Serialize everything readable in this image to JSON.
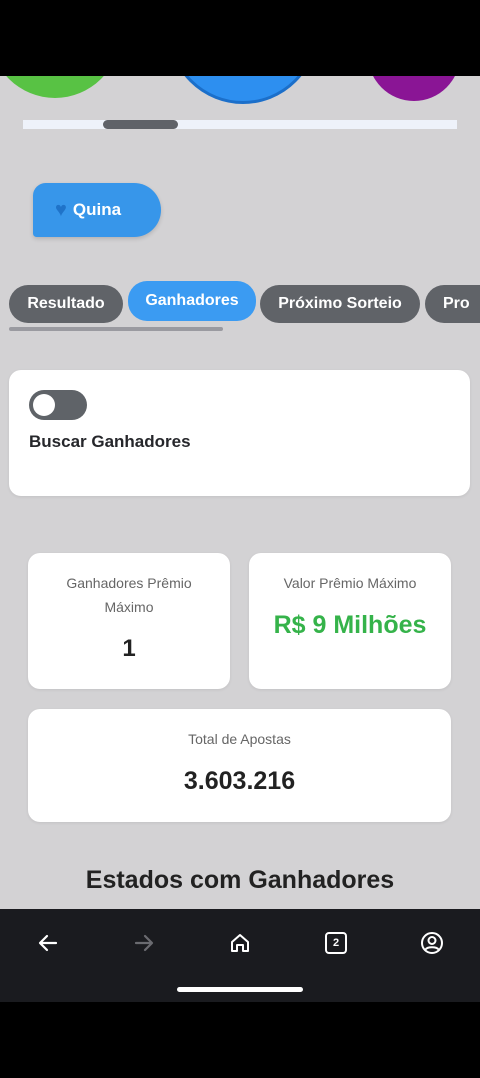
{
  "lottery_chip": {
    "label": "Quina",
    "icon": "blue-heart-icon"
  },
  "tabs": [
    {
      "label": "Resultado",
      "active": false
    },
    {
      "label": "Ganhadores",
      "active": true
    },
    {
      "label": "Próximo Sorteio",
      "active": false
    },
    {
      "label": "Pro",
      "active": false
    }
  ],
  "search": {
    "toggle_on": false,
    "label": "Buscar Ganhadores"
  },
  "stats": {
    "winners": {
      "title_line1": "Ganhadores Prêmio",
      "title_line2": "Máximo",
      "value": "1"
    },
    "prize": {
      "title": "Valor Prêmio Máximo",
      "value": "R$ 9 Milhões"
    },
    "total": {
      "title": "Total de Apostas",
      "value": "3.603.216"
    }
  },
  "section": {
    "title": "Estados com Ganhadores"
  },
  "navbar": {
    "items": [
      "back-arrow-icon",
      "forward-arrow-icon",
      "home-icon",
      "tabs-icon",
      "account-icon"
    ],
    "tabs_count": "2"
  },
  "colors": {
    "accent": "#3b9bf2",
    "prize_green": "#35b34a",
    "ball_green": "#58c244",
    "ball_blue": "#2d8ff0",
    "ball_purple": "#8a1595"
  }
}
